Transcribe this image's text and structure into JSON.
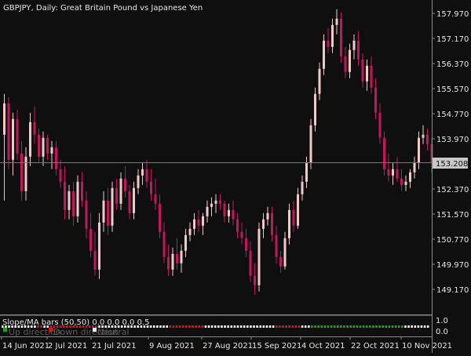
{
  "header": {
    "title": "GBPJPY, Daily:  Great Britain Pound vs Japanese Yen"
  },
  "price_axis": {
    "labels": [
      "157.970",
      "157.170",
      "156.370",
      "155.570",
      "154.770",
      "153.970",
      "153.208",
      "152.370",
      "151.570",
      "150.770",
      "149.970",
      "149.170"
    ],
    "current_price": "153.208"
  },
  "indicator": {
    "title": "Slope/MA bars (50,50) 0.0 0.0 0.0 0.5",
    "legend_up": "Up direction",
    "legend_down": "Down direction",
    "legend_neutral": "Neutral",
    "axis_labels": [
      "1.0",
      "0.0"
    ],
    "colors": {
      "up": "#22a022",
      "down": "#d8151c",
      "neutral": "#f0f0f0"
    },
    "states": "NNNNNNNNNNNDDNNDDDDDDDDDDDDDDDNNNNNNNNNNNNNNNNNNNNNNDDDDDDDDDDDNNNNNNNNNNNNNNNNNNNNNNDDDDDDDDNNNUUUUUUUUUUUUUUUUUUUUUUUUUUUUUNNNNNNNN"
  },
  "time_axis": {
    "labels": [
      "14 Jun 2021",
      "2 Jul 2021",
      "21 Jul 2021",
      "9 Aug 2021",
      "27 Aug 2021",
      "15 Sep 2021",
      "4 Oct 2021",
      "22 Oct 2021",
      "10 Nov 2021"
    ]
  },
  "colors": {
    "background": "#0f0f0f",
    "text": "#e6e6e6",
    "bull_candle": "#f2c9c9",
    "bear_candle": "#c2185b",
    "axis_line": "#8a8a8a"
  },
  "chart_data": {
    "type": "candlestick",
    "title": "GBPJPY, Daily:  Great Britain Pound vs Japanese Yen",
    "x_axis_labels": [
      "14 Jun 2021",
      "2 Jul 2021",
      "21 Jul 2021",
      "9 Aug 2021",
      "27 Aug 2021",
      "15 Sep 2021",
      "4 Oct 2021",
      "22 Oct 2021",
      "10 Nov 2021"
    ],
    "ylim": [
      148.8,
      158.4
    ],
    "last_price": 153.208,
    "series": [
      {
        "values": [
          [
            154.1,
            155.4,
            152.0,
            155.1
          ],
          [
            155.1,
            155.3,
            153.0,
            153.3
          ],
          [
            153.3,
            154.8,
            152.8,
            154.6
          ],
          [
            154.6,
            154.9,
            153.3,
            153.5
          ],
          [
            153.5,
            153.9,
            152.0,
            152.3
          ],
          [
            152.3,
            153.7,
            152.0,
            153.4
          ],
          [
            153.4,
            154.8,
            153.1,
            154.5
          ],
          [
            154.5,
            155.0,
            153.8,
            154.1
          ],
          [
            154.1,
            154.3,
            153.2,
            153.4
          ],
          [
            153.4,
            154.2,
            153.1,
            154.0
          ],
          [
            154.0,
            154.1,
            153.3,
            153.5
          ],
          [
            153.5,
            153.9,
            153.0,
            153.7
          ],
          [
            153.7,
            153.9,
            152.8,
            153.0
          ],
          [
            153.0,
            153.3,
            152.4,
            152.6
          ],
          [
            152.6,
            153.1,
            151.4,
            151.7
          ],
          [
            151.7,
            152.5,
            151.4,
            152.3
          ],
          [
            152.3,
            152.6,
            151.2,
            151.5
          ],
          [
            151.5,
            152.8,
            151.3,
            152.6
          ],
          [
            152.6,
            152.9,
            151.8,
            152.0
          ],
          [
            152.0,
            152.3,
            150.8,
            151.1
          ],
          [
            151.1,
            151.6,
            150.2,
            150.4
          ],
          [
            150.4,
            151.0,
            149.6,
            149.8
          ],
          [
            149.8,
            151.6,
            149.5,
            151.3
          ],
          [
            151.3,
            152.3,
            151.0,
            152.0
          ],
          [
            152.0,
            152.4,
            150.9,
            151.2
          ],
          [
            151.2,
            152.6,
            151.0,
            152.4
          ],
          [
            152.4,
            152.7,
            151.7,
            151.9
          ],
          [
            151.9,
            152.9,
            151.7,
            152.7
          ],
          [
            152.7,
            153.1,
            152.1,
            152.3
          ],
          [
            152.3,
            152.5,
            151.4,
            151.6
          ],
          [
            151.6,
            152.6,
            151.4,
            152.4
          ],
          [
            152.4,
            153.0,
            152.2,
            152.8
          ],
          [
            152.8,
            153.2,
            152.5,
            153.0
          ],
          [
            153.0,
            153.3,
            152.4,
            152.6
          ],
          [
            152.6,
            153.0,
            152.0,
            152.2
          ],
          [
            152.2,
            152.7,
            151.7,
            151.9
          ],
          [
            151.9,
            152.2,
            150.8,
            151.0
          ],
          [
            151.0,
            151.3,
            150.0,
            150.2
          ],
          [
            150.2,
            150.6,
            149.6,
            149.8
          ],
          [
            149.8,
            150.5,
            149.6,
            150.3
          ],
          [
            150.3,
            150.8,
            149.8,
            150.0
          ],
          [
            150.0,
            150.6,
            149.7,
            150.4
          ],
          [
            150.4,
            151.1,
            150.2,
            150.9
          ],
          [
            150.9,
            151.3,
            150.7,
            151.1
          ],
          [
            151.1,
            151.6,
            150.9,
            151.4
          ],
          [
            151.4,
            151.7,
            151.0,
            151.2
          ],
          [
            151.2,
            151.6,
            150.9,
            151.5
          ],
          [
            151.5,
            152.0,
            151.3,
            151.8
          ],
          [
            151.8,
            152.1,
            151.5,
            151.9
          ],
          [
            151.9,
            152.2,
            151.6,
            152.0
          ],
          [
            152.0,
            152.2,
            151.7,
            151.9
          ],
          [
            151.9,
            152.0,
            151.3,
            151.5
          ],
          [
            151.5,
            151.9,
            151.3,
            151.7
          ],
          [
            151.7,
            152.0,
            151.2,
            151.4
          ],
          [
            151.4,
            151.6,
            150.8,
            151.0
          ],
          [
            151.0,
            151.3,
            150.6,
            150.8
          ],
          [
            150.8,
            151.1,
            150.2,
            150.4
          ],
          [
            150.4,
            150.7,
            149.4,
            149.6
          ],
          [
            149.6,
            150.0,
            149.0,
            149.3
          ],
          [
            149.3,
            151.3,
            149.1,
            151.1
          ],
          [
            151.1,
            151.6,
            150.8,
            151.4
          ],
          [
            151.4,
            151.8,
            151.2,
            151.6
          ],
          [
            151.6,
            151.8,
            150.7,
            150.9
          ],
          [
            150.9,
            151.2,
            150.0,
            150.2
          ],
          [
            150.2,
            150.4,
            149.7,
            149.9
          ],
          [
            149.9,
            151.0,
            149.8,
            150.8
          ],
          [
            150.8,
            151.9,
            150.6,
            151.7
          ],
          [
            151.7,
            152.0,
            151.0,
            151.2
          ],
          [
            151.2,
            152.4,
            151.1,
            152.2
          ],
          [
            152.2,
            152.8,
            152.0,
            152.6
          ],
          [
            152.6,
            153.4,
            152.4,
            153.2
          ],
          [
            153.2,
            154.6,
            153.0,
            154.4
          ],
          [
            154.4,
            155.6,
            154.2,
            155.4
          ],
          [
            155.4,
            156.4,
            155.2,
            156.2
          ],
          [
            156.2,
            157.3,
            156.0,
            157.1
          ],
          [
            157.1,
            157.5,
            156.7,
            156.9
          ],
          [
            156.9,
            157.8,
            156.7,
            157.6
          ],
          [
            157.6,
            158.1,
            157.3,
            157.8
          ],
          [
            157.8,
            158.0,
            156.4,
            156.6
          ],
          [
            156.6,
            156.9,
            155.9,
            156.1
          ],
          [
            156.1,
            157.0,
            155.9,
            156.8
          ],
          [
            156.8,
            157.3,
            156.5,
            157.1
          ],
          [
            157.1,
            157.4,
            156.3,
            156.5
          ],
          [
            156.5,
            156.7,
            155.6,
            155.8
          ],
          [
            155.8,
            156.5,
            155.5,
            156.3
          ],
          [
            156.3,
            156.6,
            155.4,
            155.6
          ],
          [
            155.6,
            155.9,
            154.6,
            154.8
          ],
          [
            154.8,
            155.1,
            153.8,
            154.0
          ],
          [
            154.0,
            154.2,
            152.8,
            153.0
          ],
          [
            153.0,
            153.5,
            152.6,
            152.8
          ],
          [
            152.8,
            153.2,
            152.5,
            153.0
          ],
          [
            153.0,
            153.4,
            152.6,
            152.7
          ],
          [
            152.7,
            153.0,
            152.3,
            152.5
          ],
          [
            152.5,
            152.8,
            152.3,
            152.6
          ],
          [
            152.6,
            153.0,
            152.4,
            152.9
          ],
          [
            152.9,
            153.4,
            152.7,
            153.2
          ],
          [
            153.2,
            154.2,
            153.0,
            154.0
          ],
          [
            154.0,
            154.4,
            153.8,
            154.1
          ],
          [
            154.1,
            154.3,
            153.6,
            153.8
          ],
          [
            153.8,
            154.0,
            152.9,
            153.2
          ]
        ]
      }
    ]
  }
}
